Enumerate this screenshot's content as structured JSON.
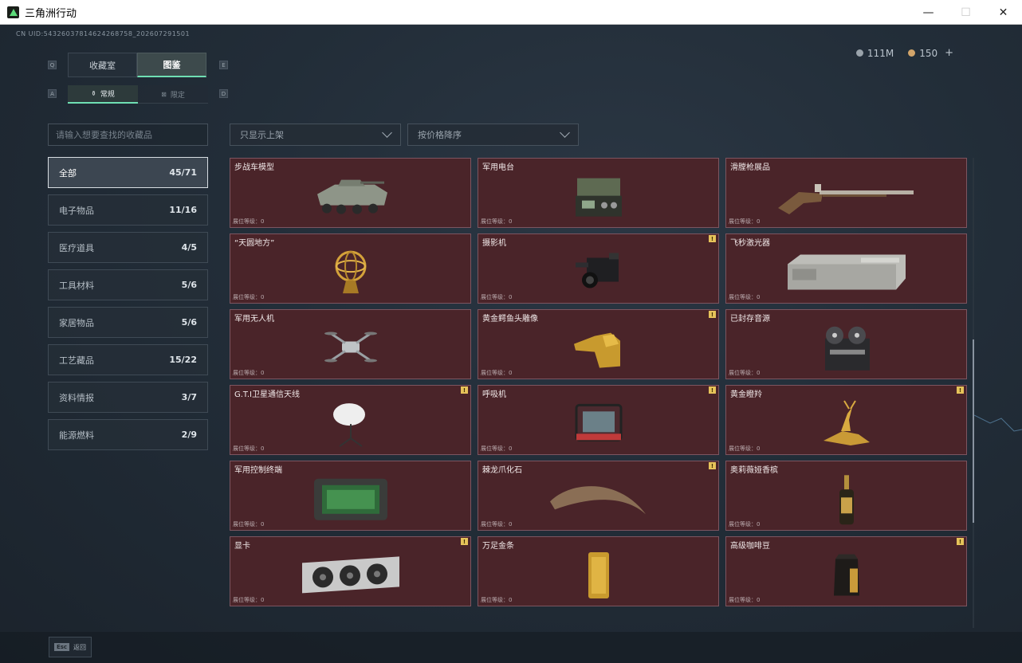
{
  "window": {
    "title": "三角洲行动",
    "minimize": "—",
    "maximize": "☐",
    "close": "✕"
  },
  "uid": "CN UID:54326037814624268758_202607291501",
  "currency": {
    "silver": "111M",
    "gold": "150",
    "add": "+"
  },
  "keyhints": {
    "q": "Q",
    "e": "E",
    "a": "A",
    "d": "D"
  },
  "tabs": [
    {
      "label": "收藏室"
    },
    {
      "label": "图鉴"
    }
  ],
  "subtabs": [
    {
      "label": "常规",
      "icon": "⚱"
    },
    {
      "label": "限定",
      "icon": "⊠"
    }
  ],
  "search": {
    "placeholder": "请输入想要查找的收藏品"
  },
  "filters": {
    "listed": "只显示上架",
    "sort": "按价格降序"
  },
  "categories": [
    {
      "label": "全部",
      "count": "45/71"
    },
    {
      "label": "电子物品",
      "count": "11/16"
    },
    {
      "label": "医疗道具",
      "count": "4/5"
    },
    {
      "label": "工具材料",
      "count": "5/6"
    },
    {
      "label": "家居物品",
      "count": "5/6"
    },
    {
      "label": "工艺藏品",
      "count": "15/22"
    },
    {
      "label": "资料情报",
      "count": "3/7"
    },
    {
      "label": "能源燃料",
      "count": "2/9"
    }
  ],
  "level_label": "展位等级：0",
  "items": [
    {
      "name": "步战车模型",
      "badge": ""
    },
    {
      "name": "军用电台",
      "badge": ""
    },
    {
      "name": "滑膛枪展品",
      "badge": ""
    },
    {
      "name": "“天圆地方”",
      "badge": ""
    },
    {
      "name": "摄影机",
      "badge": "!"
    },
    {
      "name": "飞秒激光器",
      "badge": ""
    },
    {
      "name": "军用无人机",
      "badge": ""
    },
    {
      "name": "黄金鳄鱼头雕像",
      "badge": "!"
    },
    {
      "name": "已封存音源",
      "badge": ""
    },
    {
      "name": "G.T.I卫星通信天线",
      "badge": "!"
    },
    {
      "name": "呼吸机",
      "badge": "!"
    },
    {
      "name": "黄金瞪羚",
      "badge": "!"
    },
    {
      "name": "军用控制终端",
      "badge": ""
    },
    {
      "name": "棘龙爪化石",
      "badge": "!"
    },
    {
      "name": "奥莉薇娅香槟",
      "badge": ""
    },
    {
      "name": "显卡",
      "badge": "!"
    },
    {
      "name": "万足金条",
      "badge": ""
    },
    {
      "name": "高级咖啡豆",
      "badge": "!"
    }
  ],
  "bottom": {
    "esc_key": "Esc",
    "back": "返回"
  }
}
